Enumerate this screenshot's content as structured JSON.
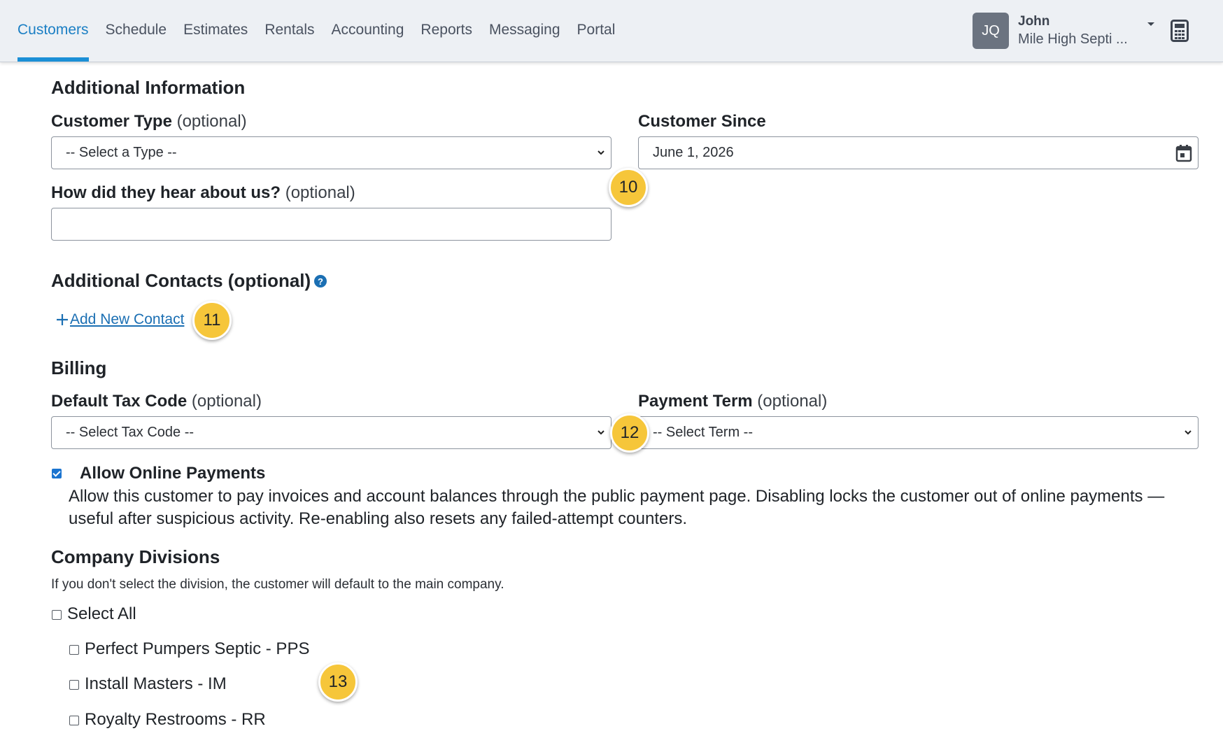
{
  "nav": {
    "tabs": [
      {
        "label": "Customers",
        "active": true
      },
      {
        "label": "Schedule"
      },
      {
        "label": "Estimates"
      },
      {
        "label": "Rentals"
      },
      {
        "label": "Accounting"
      },
      {
        "label": "Reports"
      },
      {
        "label": "Messaging"
      },
      {
        "label": "Portal"
      }
    ],
    "user": {
      "initials": "JQ",
      "name": "John",
      "company": "Mile High Septi ..."
    },
    "calculator_icon": "calculator-icon"
  },
  "additional_info": {
    "heading": "Additional Information",
    "customer_type": {
      "label": "Customer Type",
      "optional": "(optional)",
      "value": "-- Select a Type --"
    },
    "customer_since": {
      "label": "Customer Since",
      "value": "June 1, 2026"
    },
    "hear_about": {
      "label": "How did they hear about us?",
      "optional": "(optional)",
      "value": ""
    }
  },
  "contacts": {
    "heading": "Additional Contacts (optional)",
    "help_icon": "question-circle-icon",
    "add_label": "Add New Contact"
  },
  "billing": {
    "heading": "Billing",
    "tax_code": {
      "label": "Default Tax Code",
      "optional": "(optional)",
      "value": "-- Select Tax Code --"
    },
    "payment_term": {
      "label": "Payment Term",
      "optional": "(optional)",
      "value": "-- Select Term --"
    },
    "online_payments": {
      "checked": true,
      "label": "Allow Online Payments",
      "description": "Allow this customer to pay invoices and account balances through the public payment page. Disabling locks the customer out of online payments — useful after suspicious activity. Re-enabling also resets any failed-attempt counters."
    }
  },
  "divisions": {
    "heading": "Company Divisions",
    "hint": "If you don't select the division, the customer will default to the main company.",
    "select_all": "Select All",
    "items": [
      {
        "label": "Perfect Pumpers Septic - PPS",
        "checked": false
      },
      {
        "label": "Install Masters - IM",
        "checked": false
      },
      {
        "label": "Royalty Restrooms - RR",
        "checked": false
      }
    ]
  },
  "markers": [
    "10",
    "11",
    "12",
    "13"
  ],
  "colors": {
    "accent": "#1b8fd6",
    "link": "#1b6fb3",
    "marker": "#f6c63a",
    "nav_bg": "#edf0f4"
  }
}
